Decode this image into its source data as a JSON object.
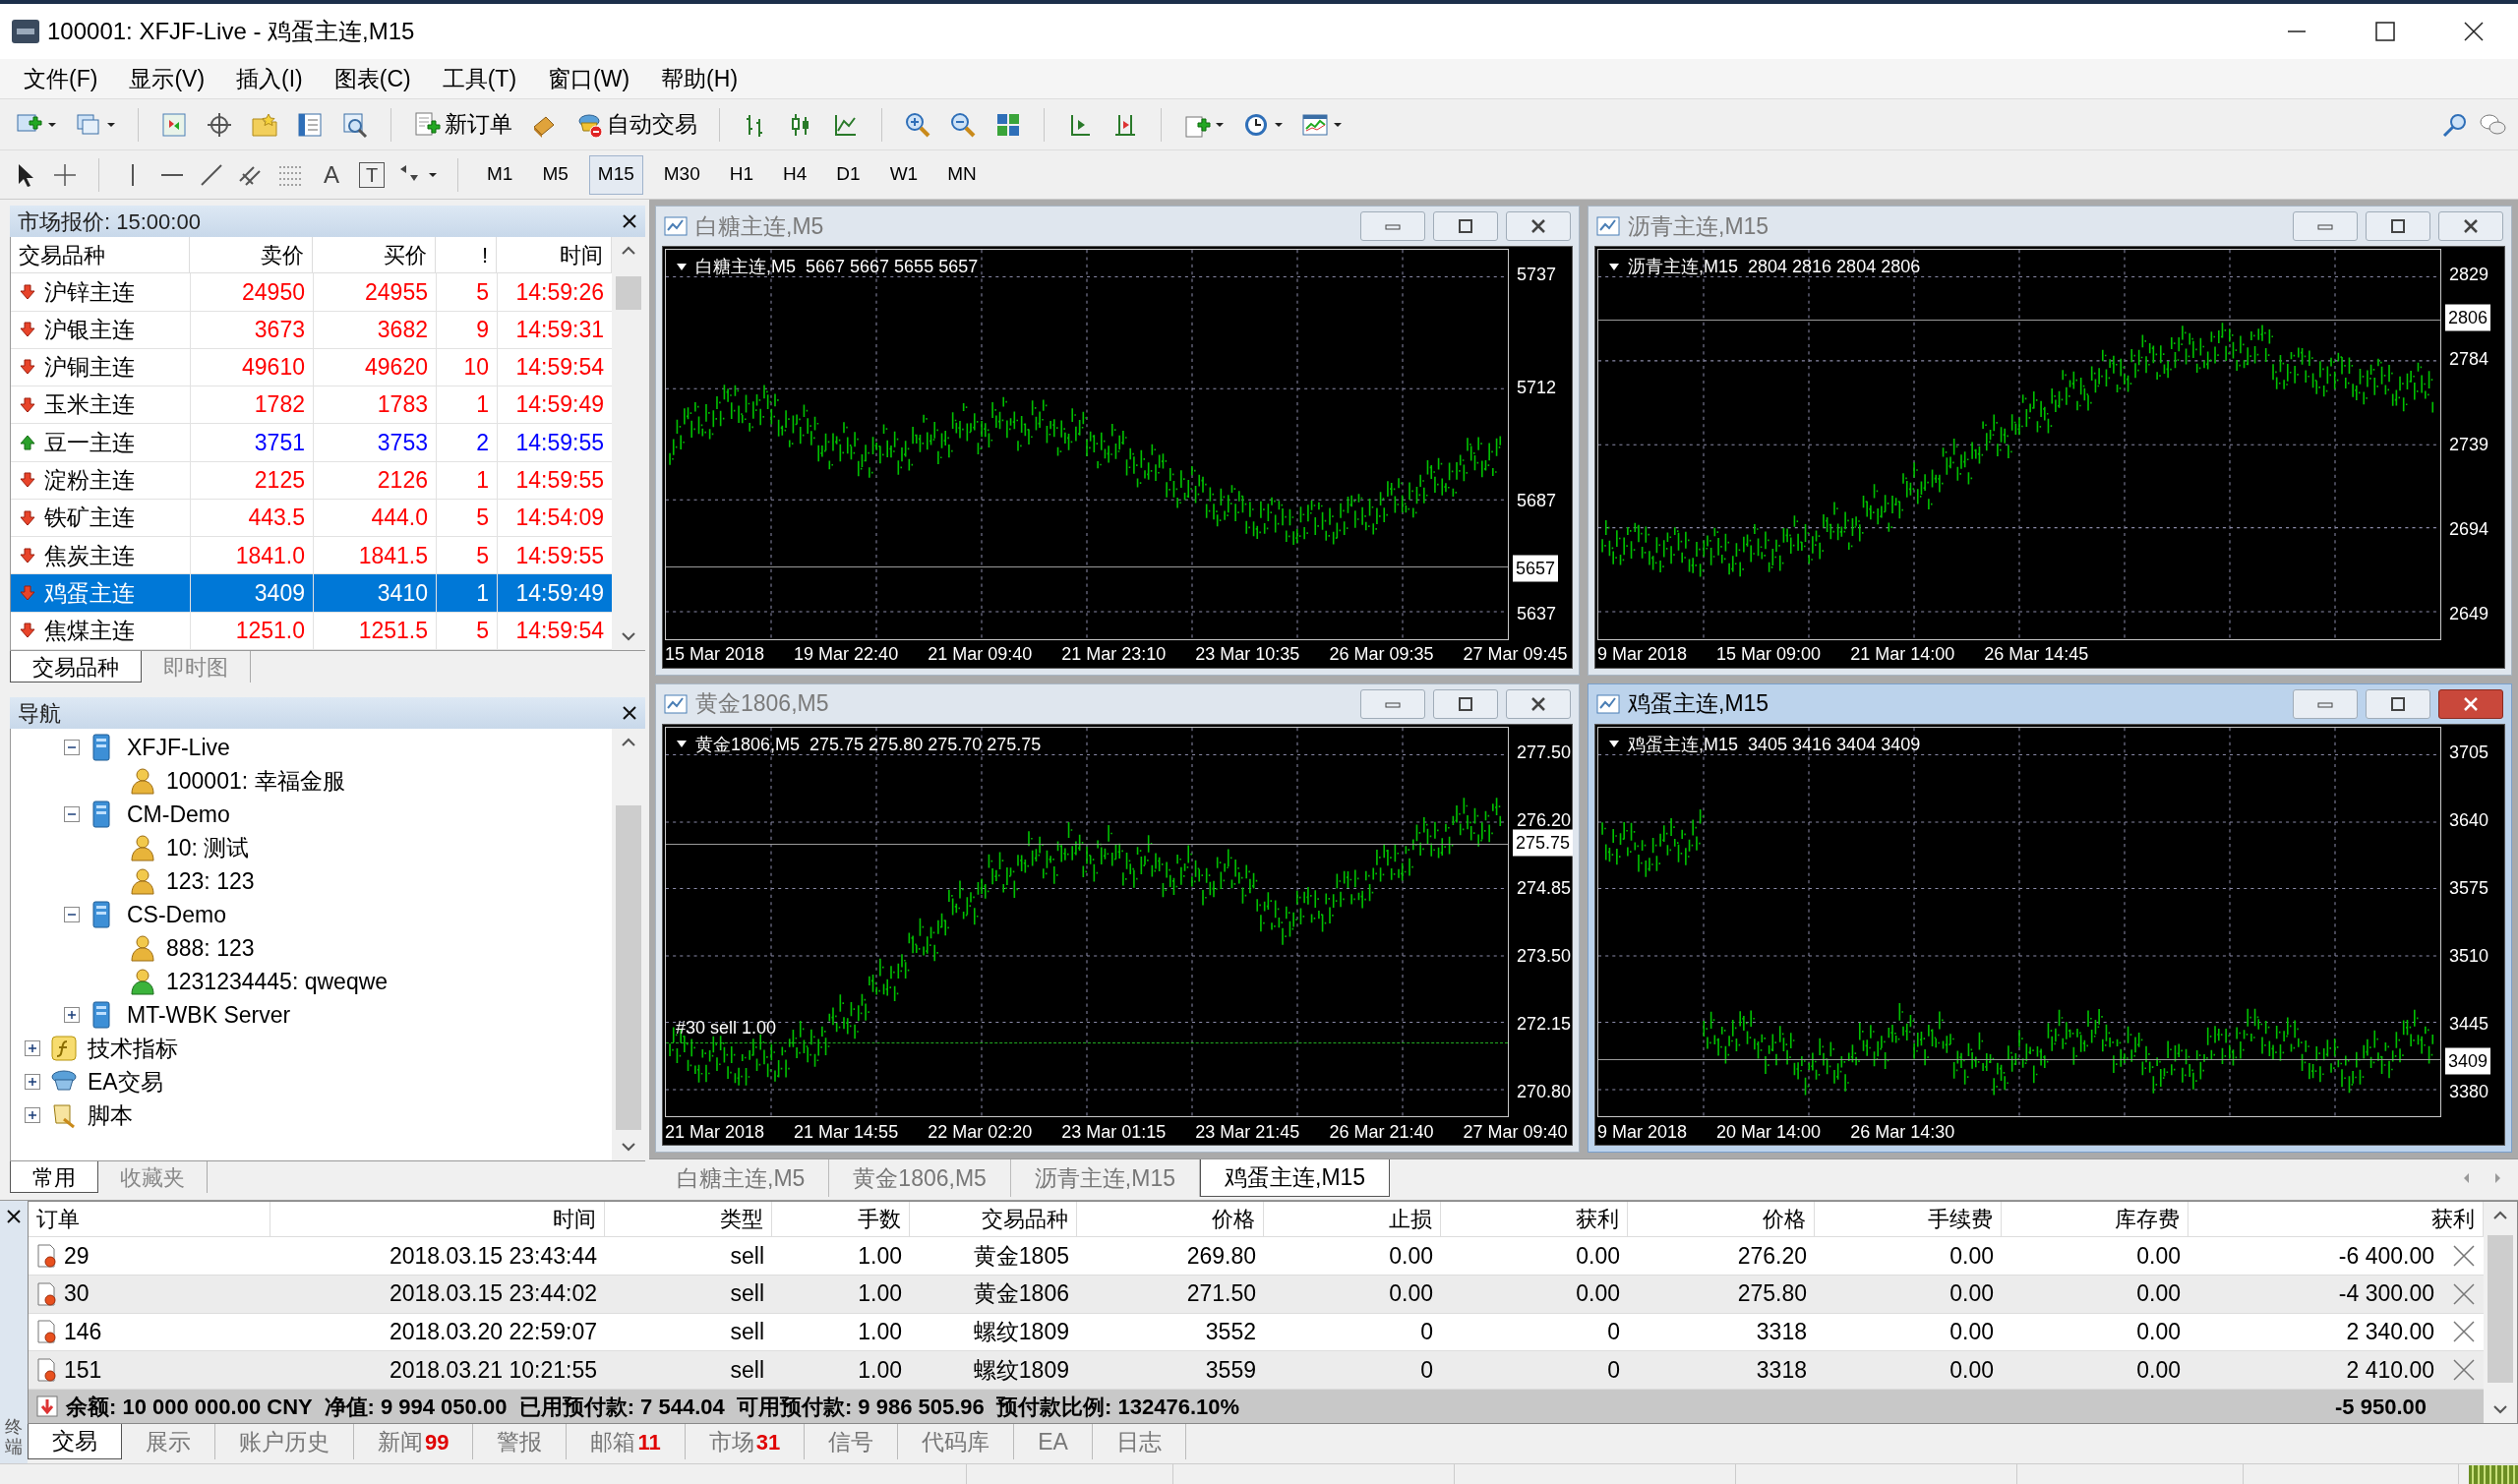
{
  "window": {
    "title": "100001: XFJF-Live - 鸡蛋主连,M15"
  },
  "menu": [
    "文件(F)",
    "显示(V)",
    "插入(I)",
    "图表(C)",
    "工具(T)",
    "窗口(W)",
    "帮助(H)"
  ],
  "toolbar": {
    "new_order": "新订单",
    "auto_trading": "自动交易",
    "text_tool": "A",
    "label_tool": "T"
  },
  "timeframes": [
    {
      "label": "M1",
      "selected": false
    },
    {
      "label": "M5",
      "selected": false
    },
    {
      "label": "M15",
      "selected": true
    },
    {
      "label": "M30",
      "selected": false
    },
    {
      "label": "H1",
      "selected": false
    },
    {
      "label": "H4",
      "selected": false
    },
    {
      "label": "D1",
      "selected": false
    },
    {
      "label": "W1",
      "selected": false
    },
    {
      "label": "MN",
      "selected": false
    }
  ],
  "market_watch": {
    "title": "市场报价: 15:00:00",
    "columns": [
      "交易品种",
      "卖价",
      "买价",
      "!",
      "时间"
    ],
    "rows": [
      {
        "symbol": "沪锌主连",
        "bid": "24950",
        "ask": "24955",
        "spread": "5",
        "time": "14:59:26",
        "rising": false,
        "selected": false
      },
      {
        "symbol": "沪银主连",
        "bid": "3673",
        "ask": "3682",
        "spread": "9",
        "time": "14:59:31",
        "rising": false,
        "selected": false
      },
      {
        "symbol": "沪铜主连",
        "bid": "49610",
        "ask": "49620",
        "spread": "10",
        "time": "14:59:54",
        "rising": false,
        "selected": false
      },
      {
        "symbol": "玉米主连",
        "bid": "1782",
        "ask": "1783",
        "spread": "1",
        "time": "14:59:49",
        "rising": false,
        "selected": false
      },
      {
        "symbol": "豆一主连",
        "bid": "3751",
        "ask": "3753",
        "spread": "2",
        "time": "14:59:55",
        "rising": true,
        "selected": false
      },
      {
        "symbol": "淀粉主连",
        "bid": "2125",
        "ask": "2126",
        "spread": "1",
        "time": "14:59:55",
        "rising": false,
        "selected": false
      },
      {
        "symbol": "铁矿主连",
        "bid": "443.5",
        "ask": "444.0",
        "spread": "5",
        "time": "14:54:09",
        "rising": false,
        "selected": false
      },
      {
        "symbol": "焦炭主连",
        "bid": "1841.0",
        "ask": "1841.5",
        "spread": "5",
        "time": "14:59:55",
        "rising": false,
        "selected": false
      },
      {
        "symbol": "鸡蛋主连",
        "bid": "3409",
        "ask": "3410",
        "spread": "1",
        "time": "14:59:49",
        "rising": false,
        "selected": true
      },
      {
        "symbol": "焦煤主连",
        "bid": "1251.0",
        "ask": "1251.5",
        "spread": "5",
        "time": "14:59:54",
        "rising": false,
        "selected": false
      }
    ],
    "tabs": [
      {
        "label": "交易品种",
        "selected": true
      },
      {
        "label": "即时图",
        "selected": false
      }
    ]
  },
  "navigator": {
    "title": "导航",
    "tree": [
      {
        "kind": "continued",
        "children": [
          {
            "label": "XFJF-Live",
            "kind": "server",
            "expanded": true,
            "children": [
              {
                "label": "100001: 幸福金服",
                "kind": "account",
                "active": false
              }
            ]
          },
          {
            "label": "CM-Demo",
            "kind": "server",
            "expanded": true,
            "children": [
              {
                "label": "10: 测试",
                "kind": "account",
                "active": false
              },
              {
                "label": "123: 123",
                "kind": "account",
                "active": false
              }
            ]
          },
          {
            "label": "CS-Demo",
            "kind": "server",
            "expanded": true,
            "children": [
              {
                "label": "888: 123",
                "kind": "account",
                "active": false
              },
              {
                "label": "1231234445: qweqwe",
                "kind": "account",
                "active": true
              }
            ]
          },
          {
            "label": "MT-WBK Server",
            "kind": "server",
            "expanded": false
          }
        ]
      },
      {
        "label": "技术指标",
        "kind": "indicators",
        "expanded": false
      },
      {
        "label": "EA交易",
        "kind": "experts",
        "expanded": false
      },
      {
        "label": "脚本",
        "kind": "scripts",
        "expanded": false
      }
    ],
    "tabs": [
      {
        "label": "常用",
        "selected": true
      },
      {
        "label": "收藏夹",
        "selected": false
      }
    ]
  },
  "charts": [
    {
      "title": "白糖主连,M5",
      "active": false,
      "legend": "白糖主连,M5  5667 5667 5655 5657",
      "y_ticks": [
        "5737",
        "5712",
        "5687",
        "5637"
      ],
      "current_price": "5657",
      "x_labels": [
        "15 Mar 2018",
        "19 Mar 22:40",
        "21 Mar 09:40",
        "21 Mar 23:10",
        "23 Mar 10:35",
        "26 Mar 09:35",
        "27 Mar 09:45"
      ]
    },
    {
      "title": "沥青主连,M15",
      "active": false,
      "legend": "沥青主连,M15  2804 2816 2804 2806",
      "y_ticks": [
        "2829",
        "2784",
        "2739",
        "2694",
        "2649"
      ],
      "current_price": "2806",
      "x_labels": [
        "9 Mar 2018",
        "15 Mar 09:00",
        "21 Mar 14:00",
        "26 Mar 14:45"
      ]
    },
    {
      "title": "黄金1806,M5",
      "active": false,
      "legend": "黄金1806,M5  275.75 275.80 275.70 275.75",
      "y_ticks": [
        "277.50",
        "276.20",
        "274.85",
        "273.50",
        "272.15",
        "270.80"
      ],
      "current_price": "275.75",
      "trade_label": "#30 sell 1.00",
      "x_labels": [
        "21 Mar 2018",
        "21 Mar 14:55",
        "22 Mar 02:20",
        "23 Mar 01:15",
        "23 Mar 21:45",
        "26 Mar 21:40",
        "27 Mar 09:40"
      ]
    },
    {
      "title": "鸡蛋主连,M15",
      "active": true,
      "legend": "鸡蛋主连,M15  3405 3416 3404 3409",
      "y_ticks": [
        "3705",
        "3640",
        "3575",
        "3510",
        "3445",
        "3380"
      ],
      "current_price": "3409",
      "x_labels": [
        "9 Mar 2018",
        "20 Mar 14:00",
        "26 Mar 14:30"
      ]
    }
  ],
  "chart_tabs": [
    {
      "label": "白糖主连,M5",
      "selected": false
    },
    {
      "label": "黄金1806,M5",
      "selected": false
    },
    {
      "label": "沥青主连,M15",
      "selected": false
    },
    {
      "label": "鸡蛋主连,M15",
      "selected": true
    }
  ],
  "terminal": {
    "side_label": "终端",
    "columns": [
      "订单",
      "时间",
      "类型",
      "手数",
      "交易品种",
      "价格",
      "止损",
      "获利",
      "价格",
      "手续费",
      "库存费",
      "获利"
    ],
    "rows": [
      [
        "29",
        "2018.03.15 23:43:44",
        "sell",
        "1.00",
        "黄金1805",
        "269.80",
        "0.00",
        "0.00",
        "276.20",
        "0.00",
        "0.00",
        "-6 400.00"
      ],
      [
        "30",
        "2018.03.15 23:44:02",
        "sell",
        "1.00",
        "黄金1806",
        "271.50",
        "0.00",
        "0.00",
        "275.80",
        "0.00",
        "0.00",
        "-4 300.00"
      ],
      [
        "146",
        "2018.03.20 22:59:07",
        "sell",
        "1.00",
        "螺纹1809",
        "3552",
        "0",
        "0",
        "3318",
        "0.00",
        "0.00",
        "2 340.00"
      ],
      [
        "151",
        "2018.03.21 10:21:55",
        "sell",
        "1.00",
        "螺纹1809",
        "3559",
        "0",
        "0",
        "3318",
        "0.00",
        "0.00",
        "2 410.00"
      ]
    ],
    "summary": "余额: 10 000 000.00 CNY  净值: 9 994 050.00  已用预付款: 7 544.04  可用预付款: 9 986 505.96  预付款比例: 132476.10%",
    "summary_profit": "-5 950.00",
    "tabs": [
      {
        "label": "交易",
        "selected": true
      },
      {
        "label": "展示",
        "selected": false
      },
      {
        "label": "账户历史",
        "selected": false
      },
      {
        "label": "新闻",
        "badge": "99",
        "selected": false
      },
      {
        "label": "警报",
        "selected": false
      },
      {
        "label": "邮箱",
        "badge": "11",
        "selected": false
      },
      {
        "label": "市场",
        "badge": "31",
        "selected": false
      },
      {
        "label": "信号",
        "selected": false
      },
      {
        "label": "代码库",
        "selected": false
      },
      {
        "label": "EA",
        "selected": false
      },
      {
        "label": "日志",
        "selected": false
      }
    ]
  }
}
